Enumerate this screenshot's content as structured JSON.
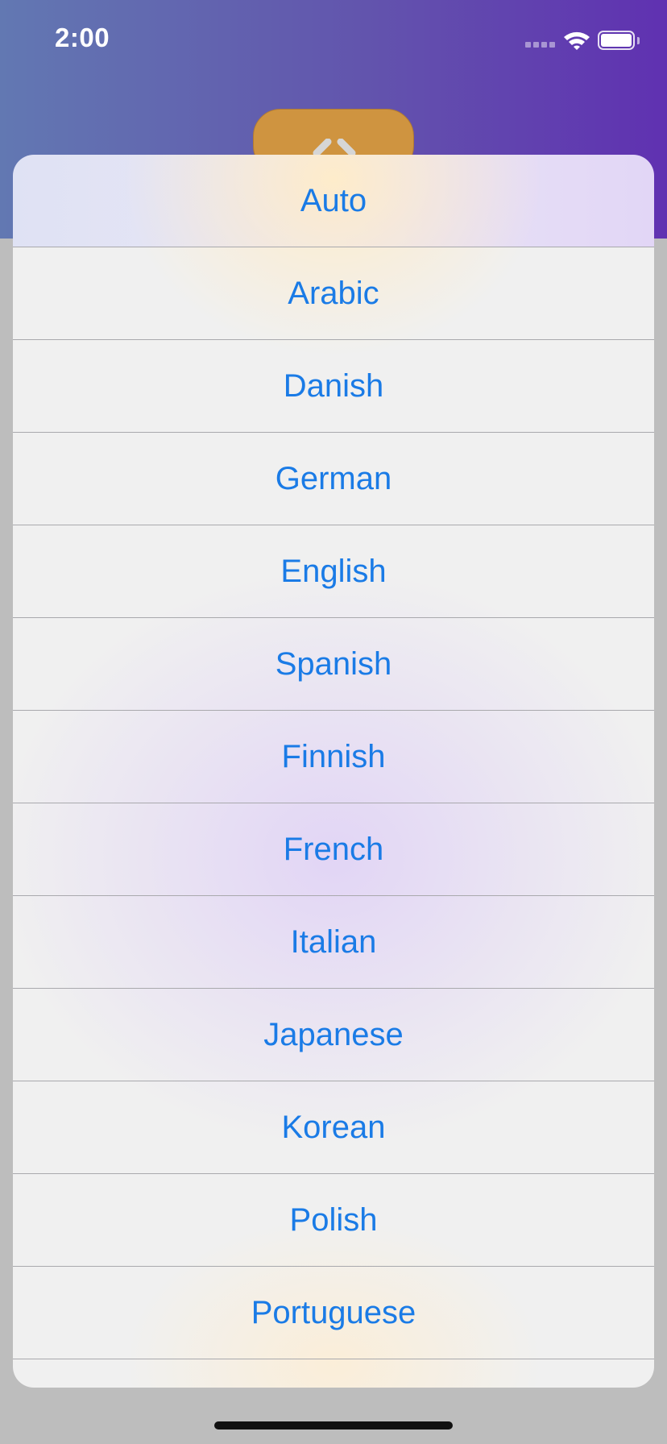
{
  "status_bar": {
    "time": "2:00"
  },
  "header": {
    "accent_color": "#6254ad",
    "swap_button_color": "#cf9440",
    "swap_icon": "swap-arrows-icon"
  },
  "language_sheet": {
    "accent_color": "#1a7be6",
    "options": [
      {
        "label": "Auto"
      },
      {
        "label": "Arabic"
      },
      {
        "label": "Danish"
      },
      {
        "label": "German"
      },
      {
        "label": "English"
      },
      {
        "label": "Spanish"
      },
      {
        "label": "Finnish"
      },
      {
        "label": "French"
      },
      {
        "label": "Italian"
      },
      {
        "label": "Japanese"
      },
      {
        "label": "Korean"
      },
      {
        "label": "Polish"
      },
      {
        "label": "Portuguese"
      },
      {
        "label": ""
      }
    ]
  }
}
